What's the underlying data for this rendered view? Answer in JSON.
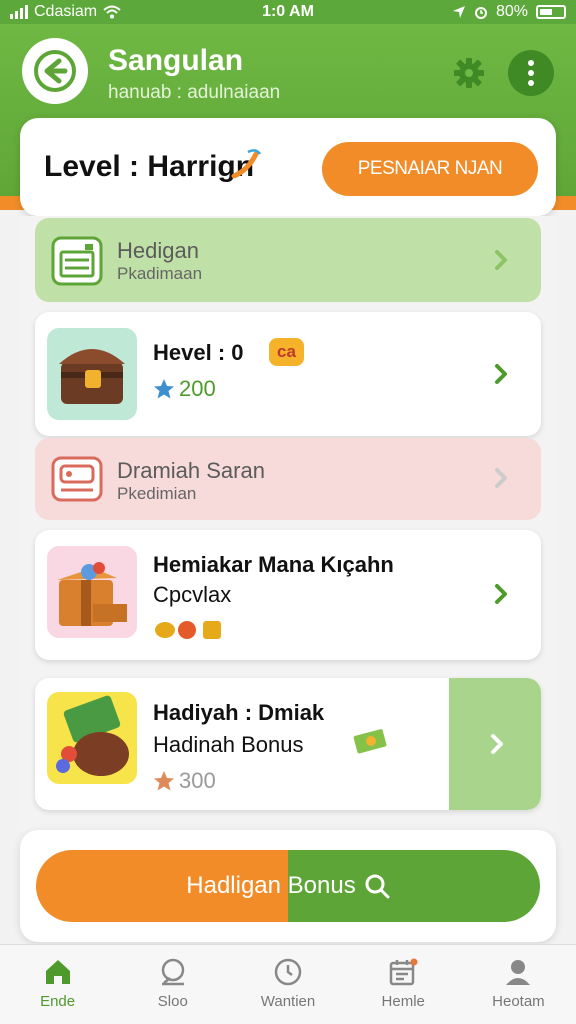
{
  "status_bar": {
    "carrier": "Cdasiam",
    "time": "1:0 AM",
    "battery": "80%"
  },
  "header": {
    "title": "Sangulan",
    "subtitle": "hanuab : adulnaiaan",
    "logo_icon": "back-arrow-logo-icon",
    "settings_icon": "gear-icon",
    "menu_icon": "more-icon"
  },
  "level_card": {
    "label": "Level :",
    "name": "Harrign",
    "button_label": "PESNAIAR NJAN"
  },
  "rows": [
    {
      "title": "Hedigan",
      "subtitle": "Pkadimaan",
      "icon": "voucher-icon",
      "style": "green"
    },
    {
      "title": "Hevel : 0",
      "badge": "ca",
      "points": "200",
      "icon": "treasure-chest-icon",
      "style": "white"
    },
    {
      "title": "Dramiah Saran",
      "subtitle": "Pkedimian",
      "icon": "card-icon",
      "style": "pink"
    },
    {
      "title": "Hemiakar Mana Kıçahn",
      "subtitle": "Cpcvlax",
      "icon": "gift-box-icon",
      "style": "white"
    },
    {
      "title": "Hadiyah : Dmiak",
      "subtitle": "Hadinah Bonus",
      "points": "300",
      "icon": "bonus-cannon-icon",
      "style": "white"
    }
  ],
  "action_button": {
    "label": "Hadligan Bonus",
    "icon": "search-icon"
  },
  "nav": [
    {
      "label": "Ende",
      "icon": "home-icon",
      "active": true
    },
    {
      "label": "Sloo",
      "icon": "chat-icon",
      "active": false
    },
    {
      "label": "Wantien",
      "icon": "clock-icon",
      "active": false
    },
    {
      "label": "Hemle",
      "icon": "calendar-icon",
      "active": false
    },
    {
      "label": "Heotam",
      "icon": "profile-icon",
      "active": false
    }
  ],
  "colors": {
    "primary_green": "#5ea537",
    "accent_orange": "#f28c28",
    "light_green": "#bfe0a6",
    "light_pink": "#f7dada"
  }
}
